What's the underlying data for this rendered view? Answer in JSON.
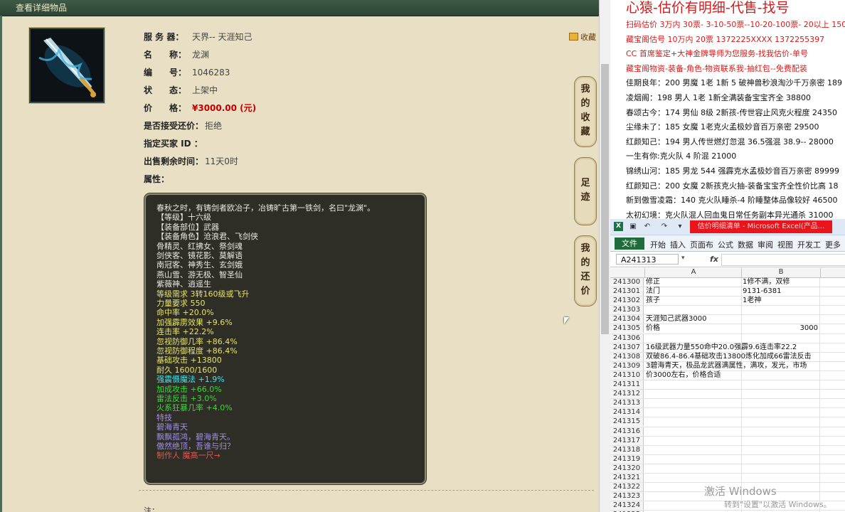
{
  "left_panel": {
    "header_title": "查看详细物品",
    "fields": [
      {
        "label": "服 务 器：",
        "value": "天界-- 天涯知己"
      },
      {
        "label": "名　　称：",
        "value": "龙渊"
      },
      {
        "label": "编　　号：",
        "value": "1046283"
      },
      {
        "label": "状　　态：",
        "value": "上架中"
      },
      {
        "label": "价　　格：",
        "value": "¥3000.00 (元)"
      },
      {
        "label": "是否接受还价：",
        "value": "拒绝"
      },
      {
        "label": "指定买家 ID ：",
        "value": ""
      },
      {
        "label": "出售剩余时间：",
        "value": "11天0时"
      },
      {
        "label": "属性：",
        "value": ""
      }
    ],
    "favorite_link": "收藏",
    "side_tabs": [
      "我的收藏",
      "足迹",
      "我的还价"
    ],
    "description_lines": [
      {
        "text": "春秋之时，有铸剑者欧冶子，冶铸旷古第一铁剑，名曰\"龙渊\"。",
        "color": "w"
      },
      {
        "text": "【等级】十六级",
        "color": "w"
      },
      {
        "text": "【装备部位】武器",
        "color": "w"
      },
      {
        "text": "【装备角色】沧浪君、飞剑侠",
        "color": "w"
      },
      {
        "text": "骨精灵、红拂女、祭剑魂",
        "color": "w"
      },
      {
        "text": "剑侠客、镜花影、莫解语",
        "color": "w"
      },
      {
        "text": "南冠客、神秀生、玄剑娥",
        "color": "w"
      },
      {
        "text": "燕山雪、游无极、智圣仙",
        "color": "w"
      },
      {
        "text": "紫薇神、逍遥生",
        "color": "w"
      },
      {
        "text": "等级需求 3转160级或飞升",
        "color": "y"
      },
      {
        "text": "力量要求 550",
        "color": "y"
      },
      {
        "text": "命中率 +20.0%",
        "color": "y"
      },
      {
        "text": "加强霹雳效果 +9.6%",
        "color": "y"
      },
      {
        "text": "连击率 +22.2%",
        "color": "y"
      },
      {
        "text": "忽视防御几率 +86.4%",
        "color": "y"
      },
      {
        "text": "忽视防御程度 +86.4%",
        "color": "y"
      },
      {
        "text": "基础攻击 +13800",
        "color": "y"
      },
      {
        "text": "耐久 1600/1600",
        "color": "y"
      },
      {
        "text": "强震慑魔法 +1.9%",
        "color": "c"
      },
      {
        "text": "加成攻击 +66.0%",
        "color": "g"
      },
      {
        "text": "雷法反击 +3.0%",
        "color": "g"
      },
      {
        "text": "火系狂暴几率 +4.0%",
        "color": "g"
      },
      {
        "text": "特技",
        "color": "p"
      },
      {
        "text": "碧海青天",
        "color": "p"
      },
      {
        "text": "飘飘孤鸿，碧海青天。",
        "color": "p"
      },
      {
        "text": "傲然绝顶，吾谁与归？",
        "color": "p"
      },
      {
        "text": "制作人 魔高一尺→",
        "color": "r"
      }
    ],
    "note_label": "注："
  },
  "doc_panel": {
    "title": "心猿-估价有明细-代售-找号",
    "lines": [
      {
        "text": "扫码估价 3万内 30票- 3-10-50票--10-20-100票- 20以上 150+",
        "red": true
      },
      {
        "text": "藏宝阁估号 10万内 20票 1372225XXXX  1372255397",
        "red": true
      },
      {
        "text": "CC 首席鉴定+大神金牌导师为您服务-找我估价-单号",
        "red": true
      },
      {
        "text": "藏宝阁物资-装备-角色-物资联系我-抽红包--免费配装",
        "red": true
      },
      {
        "text": "佳期良年：200 男魔 1老 1新 5 破神兽秒浪淘沙千万亲密 189",
        "red": false
      },
      {
        "text": "凌烟阁：198 男人 1老 1新全满装备宝宝齐全 38800",
        "red": false
      },
      {
        "text": "春颂古今：174 男仙 8级 2新孩-传世容止风克火程度 24350",
        "red": false
      },
      {
        "text": "尘缘未了：185 女魔 1老克火孟极妙音百万亲密 29500",
        "red": false
      },
      {
        "text": "红颜知己：194 男人传世燃灯忽混 36.5强混 38.9-- 28000",
        "red": false
      },
      {
        "text": "一生有你:克火队 4 阶混 21000",
        "red": false
      },
      {
        "text": "锦绣山河：185 男龙 544 强霹克水孟极妙音百万亲密 89999",
        "red": false
      },
      {
        "text": "红颜知己：200 女魔 2新孩克火抽-装备宝宝齐全性价比高 18",
        "red": false
      },
      {
        "text": "新到傲雪凌霜：140 克火队睡杀-4 阶睡整体品像较好 46500",
        "red": false
      },
      {
        "text": "太初幻境：克火队混人回血鬼日常任务副本异光通杀 31000",
        "red": false
      }
    ]
  },
  "excel": {
    "title": "估价明细清单 - Microsoft Excel(产品...",
    "file_tab": "文件",
    "ribbon_tabs": [
      "开始",
      "插入",
      "页面布",
      "公式",
      "数据",
      "审阅",
      "视图",
      "开发工",
      "更多"
    ],
    "name_box": "A241313",
    "fx": "fx",
    "col_a": "A",
    "col_b": "B",
    "rows": [
      {
        "n": "241300",
        "a": "修正",
        "b": "1修不满，双修"
      },
      {
        "n": "241301",
        "a": "法门",
        "b": "9131-6381"
      },
      {
        "n": "241302",
        "a": "孩子",
        "b": "1老神"
      },
      {
        "n": "241303",
        "a": "",
        "b": ""
      },
      {
        "n": "241304",
        "a": "天涯知己武器3000",
        "b": ""
      },
      {
        "n": "241305",
        "a": "价格",
        "b": "3000"
      },
      {
        "n": "241306",
        "a": "",
        "b": ""
      },
      {
        "n": "241307",
        "a": "16级武器力量550命中20.0强霹9.6连击率22.2",
        "b": ""
      },
      {
        "n": "241308",
        "a": "双破86.4-86.4基础攻击13800炼化加成66雷法反击",
        "b": ""
      },
      {
        "n": "241309",
        "a": "3碧海青天，极品龙武器满属性，满攻，发光，市场",
        "b": ""
      },
      {
        "n": "241310",
        "a": "价3000左右，价格合适",
        "b": ""
      },
      {
        "n": "241311",
        "a": "",
        "b": ""
      },
      {
        "n": "241312",
        "a": "",
        "b": ""
      },
      {
        "n": "241313",
        "a": "",
        "b": ""
      },
      {
        "n": "241314",
        "a": "",
        "b": ""
      },
      {
        "n": "241315",
        "a": "",
        "b": ""
      },
      {
        "n": "241316",
        "a": "",
        "b": ""
      },
      {
        "n": "241317",
        "a": "",
        "b": ""
      },
      {
        "n": "241318",
        "a": "",
        "b": ""
      },
      {
        "n": "241319",
        "a": "",
        "b": ""
      },
      {
        "n": "241320",
        "a": "",
        "b": ""
      },
      {
        "n": "241321",
        "a": "",
        "b": ""
      },
      {
        "n": "241322",
        "a": "",
        "b": ""
      },
      {
        "n": "241323",
        "a": "",
        "b": ""
      },
      {
        "n": "241324",
        "a": "",
        "b": ""
      },
      {
        "n": "241325",
        "a": "",
        "b": ""
      },
      {
        "n": "241326",
        "a": "",
        "b": ""
      }
    ]
  },
  "watermark": {
    "line1": "激活 Windows",
    "line2": "转到\"设置\"以激活 Windows。"
  },
  "colors": {
    "w": "#e8e8e0",
    "y": "#e6e36a",
    "c": "#40e6f0",
    "g": "#3cd83c",
    "p": "#a48ee6",
    "r": "#f25050"
  }
}
